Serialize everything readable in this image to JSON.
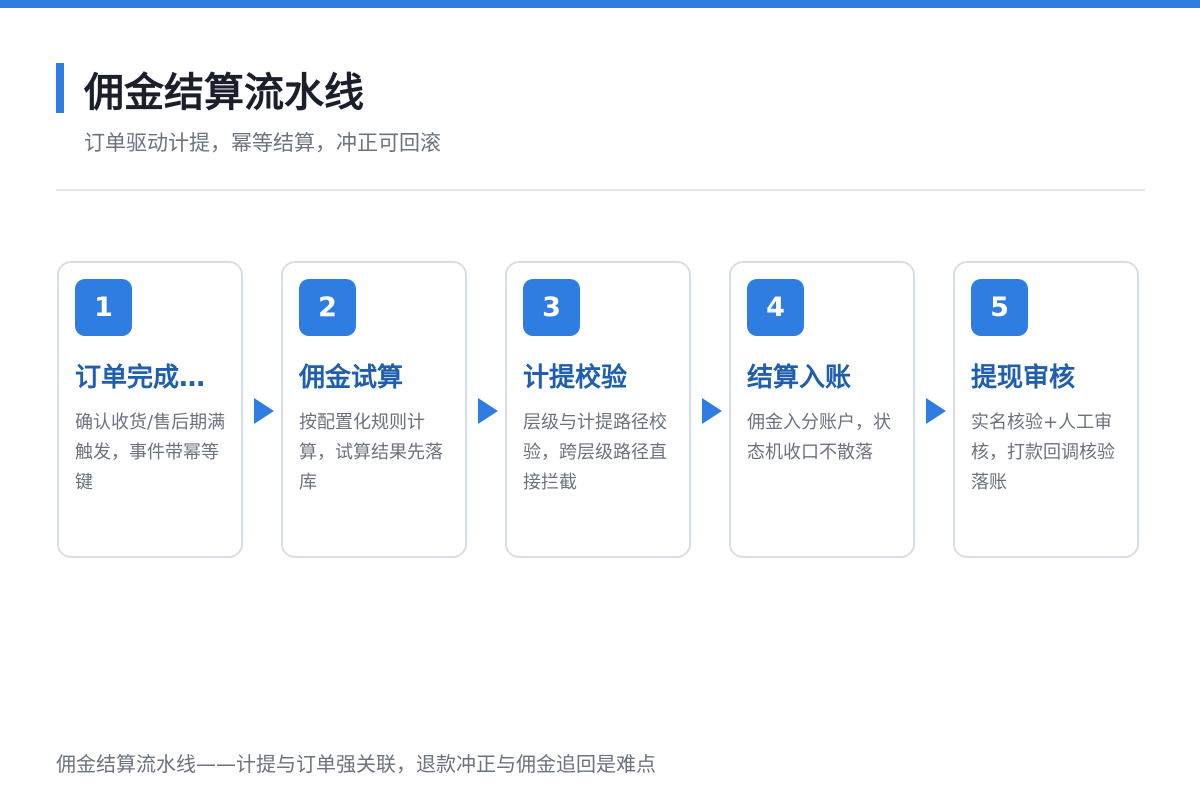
{
  "header": {
    "title": "佣金结算流水线",
    "subtitle": "订单驱动计提，幂等结算，冲正可回滚"
  },
  "steps": [
    {
      "number": "1",
      "title": "订单完成…",
      "description": "确认收货/售后期满触发，事件带幂等键"
    },
    {
      "number": "2",
      "title": "佣金试算",
      "description": "按配置化规则计算，试算结果先落库"
    },
    {
      "number": "3",
      "title": "计提校验",
      "description": "层级与计提路径校验，跨层级路径直接拦截"
    },
    {
      "number": "4",
      "title": "结算入账",
      "description": "佣金入分账户，状态机收口不散落"
    },
    {
      "number": "5",
      "title": "提现审核",
      "description": "实名核验+人工审核，打款回调核验落账"
    }
  ],
  "footer": {
    "note": "佣金结算流水线——计提与订单强关联，退款冲正与佣金追回是难点"
  },
  "colors": {
    "accent": "#2f7de1",
    "title_text": "#1a1f2b",
    "step_title": "#1f5fad",
    "muted_text": "#6b7380",
    "card_border": "#d6dee8"
  },
  "icons": {
    "flow_arrow": "triangle-right"
  }
}
